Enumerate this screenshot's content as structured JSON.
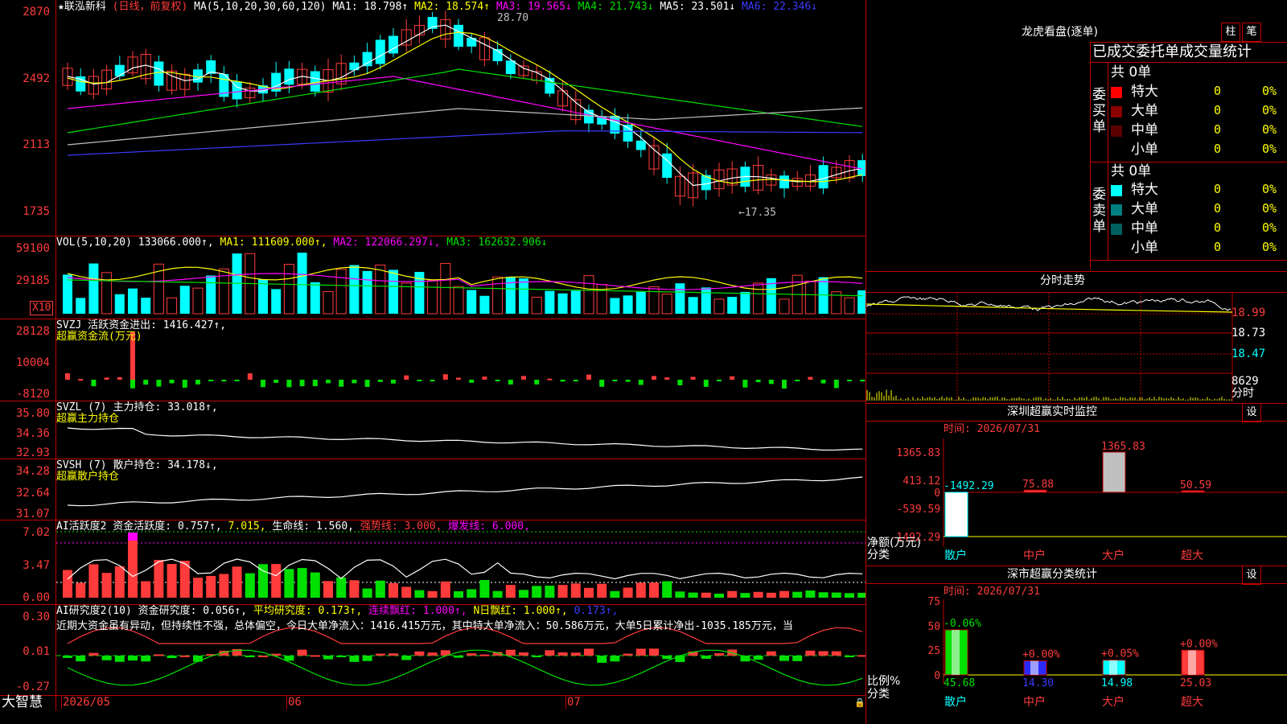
{
  "header": {
    "stock_title": "★联泓新科",
    "mode": "(日线，前复权)",
    "ma_params": "MA(5,10,20,30,60,120)",
    "ma1": "MA1: 18.798↑",
    "ma2": "MA2: 18.574↑",
    "ma3": "MA3: 19.565↓",
    "ma4": "MA4: 21.743↓",
    "ma5": "MA5: 23.501↓",
    "ma6": "MA6: 22.346↓",
    "high_marker": "28.70",
    "low_marker": "←17.35"
  },
  "price_axis": [
    "2870",
    "2492",
    "2113",
    "1735"
  ],
  "vol_panel": {
    "title": "VOL(5,10,20) 133066.000↑,",
    "ma1": "MA1: 111609.000↑,",
    "ma2": "MA2: 122066.297↓,",
    "ma3": "MA3: 162632.906↓",
    "axis": [
      "59100",
      "29185"
    ],
    "unit": "X10"
  },
  "svzj_panel": {
    "title": "SVZJ  活跃资金进出: 1416.427↑,",
    "subtitle": "超赢资金流(万元)",
    "axis": [
      "28128",
      "10004",
      "-8120"
    ]
  },
  "svzl_panel": {
    "title": "SVZL (7) 主力持仓: 33.018↑,",
    "subtitle": "超赢主力持仓",
    "axis": [
      "35.80",
      "34.36",
      "32.93"
    ]
  },
  "svsh_panel": {
    "title": "SVSH (7) 散户持仓: 34.178↓,",
    "subtitle": "超赢散户持仓",
    "axis": [
      "34.28",
      "32.64",
      "31.07"
    ]
  },
  "ai_active_panel": {
    "title": "AI活跃度2 资金活跃度: 0.757↑,",
    "v2": "7.015,",
    "life_line": "生命线: 1.560,",
    "strong_line": "强势线: 3.000,",
    "burst_line": "爆发线: 6.000,",
    "axis": [
      "7.02",
      "3.47",
      "0.00"
    ]
  },
  "ai_research_panel": {
    "title": "AI研究度2(10) 资金研究度: 0.056↑,",
    "avg": "平均研究度: 0.173↑,",
    "streak": "连续飘红: 1.000↑,",
    "nday": "N日飘红: 1.000↑,",
    "v5": "0.173↑,",
    "comment": "近期大资金虽有异动，但持续性不强，总体偏空，今日大单净流入：1416.415万元，其中特大单净流入：50.586万元，大单5日累计净出-1035.185万元，当",
    "axis": [
      "0.30",
      "0.01",
      "-0.27"
    ]
  },
  "bottom_bar": {
    "brand": "大智慧",
    "dates": [
      "2026/05",
      "06",
      "07"
    ]
  },
  "right_panel": {
    "dragon_title": "龙虎看盘(逐单)",
    "btn_zhu": "柱",
    "btn_bi": "笔",
    "stat_title": "已成交委托单成交量统计",
    "buy_label": "委买单",
    "sell_label": "委卖单",
    "buy_total": "共 0单",
    "sell_total": "共 0单",
    "rows": [
      "特大",
      "大单",
      "中单",
      "小单"
    ],
    "row_values": [
      "0",
      "0",
      "0",
      "0"
    ],
    "row_pct": [
      "0%",
      "0%",
      "0%",
      "0%"
    ],
    "intraday_title": "分时走势",
    "intraday_prices": [
      "18.99",
      "18.73",
      "18.47"
    ],
    "intraday_vol": "8629",
    "intraday_vol_unit": "分时",
    "monitor_title": "深圳超赢实时监控",
    "monitor_btn": "设",
    "monitor_time": "时间: 2026/07/31",
    "monitor_axis": [
      "1365.83",
      "413.12",
      "0",
      "-539.59",
      "-1492.29"
    ],
    "monitor_ylabel": "净额(万元)",
    "monitor_xlabel": "分类",
    "monitor_cats": [
      "散户",
      "中户",
      "大户",
      "超大"
    ],
    "monitor_vals": [
      "-1492.29",
      "75.88",
      "1365.83",
      "50.59"
    ],
    "class_title": "深市超赢分类统计",
    "class_btn": "设",
    "class_time": "时间: 2026/07/31",
    "class_axis": [
      "75",
      "50",
      "25",
      "0"
    ],
    "class_ylabel": "比例%",
    "class_xlabel": "分类",
    "class_cats": [
      "散户",
      "中户",
      "大户",
      "超大"
    ],
    "class_vals": [
      "45.68",
      "14.30",
      "14.98",
      "25.03"
    ],
    "class_delta": [
      "-0.06%",
      "+0.00%",
      "+0.05%",
      "+0.00%"
    ]
  },
  "colors": {
    "up": "#ff3b3b",
    "down": "#00ffff",
    "border": "#c00000",
    "ma1": "#ffffff",
    "ma2": "#ffff00",
    "ma3": "#ff00ff",
    "ma4": "#00e000",
    "ma5": "#c0c0c0",
    "ma6": "#3b3bff"
  }
}
